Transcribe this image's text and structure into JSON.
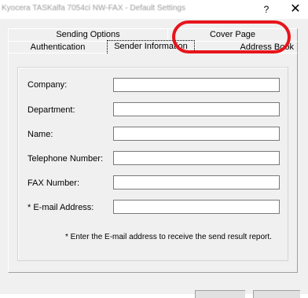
{
  "window": {
    "title": "Kyocera TASKalfa 7054ci NW-FAX - Default Settings",
    "help_label": "?",
    "close_label": "✕"
  },
  "tabs": {
    "back_row": [
      {
        "label": "Sending Options"
      },
      {
        "label": "Cover Page"
      }
    ],
    "front_row": [
      {
        "label": "Authentication"
      },
      {
        "label": "Sender Information"
      },
      {
        "label": "Address Book"
      }
    ],
    "active_tab": "Sender Information"
  },
  "form": {
    "company": {
      "label": "Company:",
      "value": ""
    },
    "department": {
      "label": "Department:",
      "value": ""
    },
    "name": {
      "label": "Name:",
      "value": ""
    },
    "telephone": {
      "label": "Telephone Number:",
      "value": ""
    },
    "fax": {
      "label": "FAX Number:",
      "value": ""
    },
    "email": {
      "label": "* E-mail Address:",
      "value": ""
    }
  },
  "note": "* Enter the E-mail address to receive the send result report.",
  "colors": {
    "annotation": "#e8141b",
    "background": "#f0f0f0"
  }
}
